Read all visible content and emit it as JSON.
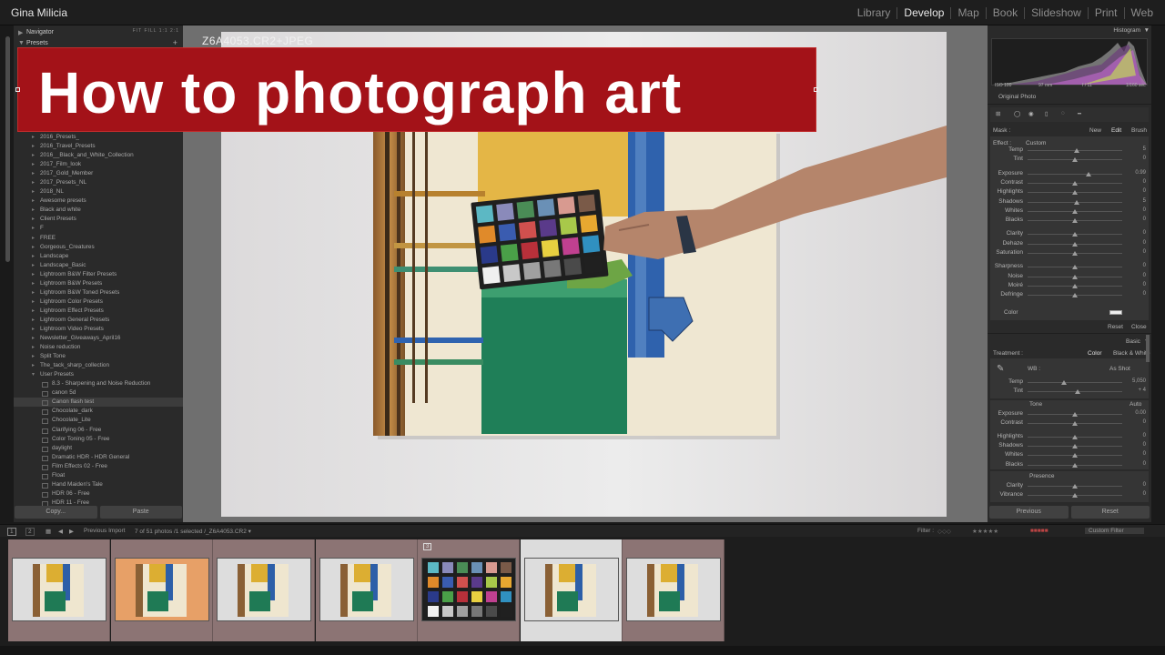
{
  "identity": "Gina Milicia",
  "modules": [
    {
      "label": "Library",
      "active": false
    },
    {
      "label": "Develop",
      "active": true
    },
    {
      "label": "Map",
      "active": false
    },
    {
      "label": "Book",
      "active": false
    },
    {
      "label": "Slideshow",
      "active": false
    },
    {
      "label": "Print",
      "active": false
    },
    {
      "label": "Web",
      "active": false
    }
  ],
  "left_panel": {
    "navigator_label": "Navigator",
    "navigator_zoom": "FIT FILL 1:1 2:1",
    "presets_label": "Presets",
    "presets": [
      {
        "label": "2016_Presets_",
        "kind": "folder"
      },
      {
        "label": "2016_Travel_Presets",
        "kind": "folder"
      },
      {
        "label": "2016__Black_and_White_Collection",
        "kind": "folder"
      },
      {
        "label": "2017_Film_look",
        "kind": "folder"
      },
      {
        "label": "2017_Gold_Member",
        "kind": "folder"
      },
      {
        "label": "2017_Presets_NL",
        "kind": "folder"
      },
      {
        "label": "2018_NL",
        "kind": "folder"
      },
      {
        "label": "Awesome presets",
        "kind": "folder"
      },
      {
        "label": "Black and white",
        "kind": "folder"
      },
      {
        "label": "Client Presets",
        "kind": "folder"
      },
      {
        "label": "F",
        "kind": "folder"
      },
      {
        "label": "FREE",
        "kind": "folder"
      },
      {
        "label": "Gorgeous_Creatures",
        "kind": "folder"
      },
      {
        "label": "Landscape",
        "kind": "folder"
      },
      {
        "label": "Landscape_Basic",
        "kind": "folder"
      },
      {
        "label": "Lightroom B&W Filter Presets",
        "kind": "folder"
      },
      {
        "label": "Lightroom B&W Presets",
        "kind": "folder"
      },
      {
        "label": "Lightroom B&W Toned Presets",
        "kind": "folder"
      },
      {
        "label": "Lightroom Color Presets",
        "kind": "folder"
      },
      {
        "label": "Lightroom Effect Presets",
        "kind": "folder"
      },
      {
        "label": "Lightroom General Presets",
        "kind": "folder"
      },
      {
        "label": "Lightroom Video Presets",
        "kind": "folder"
      },
      {
        "label": "Newsletter_Giveaways_April16",
        "kind": "folder"
      },
      {
        "label": "Noise reduction",
        "kind": "folder"
      },
      {
        "label": "Split Tone",
        "kind": "folder"
      },
      {
        "label": "The_tack_sharp_collection",
        "kind": "folder"
      },
      {
        "label": "User Presets",
        "kind": "folder-open"
      },
      {
        "label": "8.3 - Sharpening and Noise Reduction",
        "kind": "child"
      },
      {
        "label": "canon 5d",
        "kind": "child"
      },
      {
        "label": "Canon flash test",
        "kind": "child-hl"
      },
      {
        "label": "Chocolate_dark",
        "kind": "child"
      },
      {
        "label": "Chocolate_Lite",
        "kind": "child"
      },
      {
        "label": "Clarifying 06 - Free",
        "kind": "child"
      },
      {
        "label": "Color Toning 05 - Free",
        "kind": "child"
      },
      {
        "label": "daylight",
        "kind": "child"
      },
      {
        "label": "Dramatic HDR - HDR General",
        "kind": "child"
      },
      {
        "label": "Film Effects 02 - Free",
        "kind": "child"
      },
      {
        "label": "Float",
        "kind": "child"
      },
      {
        "label": "Hand Maiden's Tale",
        "kind": "child"
      },
      {
        "label": "HDR 06 - Free",
        "kind": "child"
      },
      {
        "label": "HDR 11 - Free",
        "kind": "child"
      }
    ],
    "copy_label": "Copy...",
    "paste_label": "Paste"
  },
  "center": {
    "filename": "Z6A4053.CR2+JPEG",
    "banner_text": "How to photograph art",
    "banner_color": "#a31218"
  },
  "right_panel": {
    "histogram_label": "Histogram",
    "hist_info": [
      "ISO 100",
      "97 mm",
      "f / 11",
      "1/160 sec"
    ],
    "original_photo_label": "Original Photo",
    "mask_label": "Mask :",
    "mask_options": [
      "New",
      "Edit",
      "Brush"
    ],
    "effect_label": "Effect :",
    "effect_value": "Custom",
    "local_sliders": [
      {
        "label": "Temp",
        "value": "5",
        "pos": 0.52
      },
      {
        "label": "Tint",
        "value": "0",
        "pos": 0.5
      },
      {
        "label": "Exposure",
        "value": "0.99",
        "pos": 0.64
      },
      {
        "label": "Contrast",
        "value": "0",
        "pos": 0.5
      },
      {
        "label": "Highlights",
        "value": "0",
        "pos": 0.5
      },
      {
        "label": "Shadows",
        "value": "5",
        "pos": 0.52
      },
      {
        "label": "Whites",
        "value": "0",
        "pos": 0.5
      },
      {
        "label": "Blacks",
        "value": "0",
        "pos": 0.5
      },
      {
        "label": "Clarity",
        "value": "0",
        "pos": 0.5
      },
      {
        "label": "Dehaze",
        "value": "0",
        "pos": 0.5
      },
      {
        "label": "Saturation",
        "value": "0",
        "pos": 0.5
      },
      {
        "label": "Sharpness",
        "value": "0",
        "pos": 0.5
      },
      {
        "label": "Noise",
        "value": "0",
        "pos": 0.5
      },
      {
        "label": "Moiré",
        "value": "0",
        "pos": 0.5
      },
      {
        "label": "Defringe",
        "value": "0",
        "pos": 0.5
      }
    ],
    "color_label": "Color",
    "reset_label": "Reset",
    "close_label": "Close",
    "basic_label": "Basic",
    "treatment_label": "Treatment :",
    "treatment_options": [
      "Color",
      "Black & White"
    ],
    "wb_label": "WB :",
    "wb_value": "As Shot",
    "wb_sliders": [
      {
        "label": "Temp",
        "value": "5,050",
        "pos": 0.38
      },
      {
        "label": "Tint",
        "value": "+ 4",
        "pos": 0.53
      }
    ],
    "tone_label": "Tone",
    "tone_auto": "Auto",
    "tone_sliders": [
      {
        "label": "Exposure",
        "value": "0.00",
        "pos": 0.5
      },
      {
        "label": "Contrast",
        "value": "0",
        "pos": 0.5
      },
      {
        "label": "Highlights",
        "value": "0",
        "pos": 0.5
      },
      {
        "label": "Shadows",
        "value": "0",
        "pos": 0.5
      },
      {
        "label": "Whites",
        "value": "0",
        "pos": 0.5
      },
      {
        "label": "Blacks",
        "value": "0",
        "pos": 0.5
      }
    ],
    "presence_label": "Presence",
    "presence_sliders": [
      {
        "label": "Clarity",
        "value": "0",
        "pos": 0.5
      },
      {
        "label": "Vibrance",
        "value": "0",
        "pos": 0.5
      }
    ],
    "previous_label": "Previous",
    "reset_button_label": "Reset"
  },
  "filmbar": {
    "source": "Previous Import",
    "info": "7 of 51 photos /1 selected /_Z6A4053.CR2 ▾",
    "filter_label": "Filter :",
    "filter_value": "Custom Filter"
  },
  "filmstrip": {
    "count": 7,
    "selected_index": 5,
    "chart_index": 4,
    "chart_badge": "3"
  }
}
